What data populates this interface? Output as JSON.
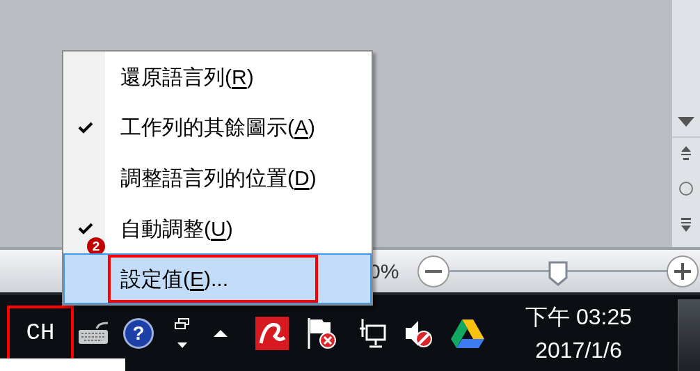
{
  "status_bar": {
    "zoom_text": "0%",
    "zoom": {
      "level": 0.5
    }
  },
  "context_menu": {
    "items": [
      {
        "label": "還原語言列(",
        "mnemonic": "R",
        "suffix": ")",
        "checked": false,
        "selected": false,
        "annotated": false
      },
      {
        "label": "工作列的其餘圖示(",
        "mnemonic": "A",
        "suffix": ")",
        "checked": true,
        "selected": false,
        "annotated": false
      },
      {
        "label": "調整語言列的位置(",
        "mnemonic": "D",
        "suffix": ")",
        "checked": false,
        "selected": false,
        "annotated": false
      },
      {
        "label": "自動調整(",
        "mnemonic": "U",
        "suffix": ")",
        "checked": true,
        "selected": false,
        "annotated": false,
        "step_badge": "2"
      },
      {
        "label": "設定值(",
        "mnemonic": "E",
        "suffix": ")...",
        "checked": false,
        "selected": true,
        "annotated": true
      }
    ]
  },
  "taskbar": {
    "language": {
      "text": "CH",
      "annotated": true
    },
    "help_glyph": "?",
    "clock": {
      "time": "下午 03:25",
      "date": "2017/1/6"
    }
  }
}
